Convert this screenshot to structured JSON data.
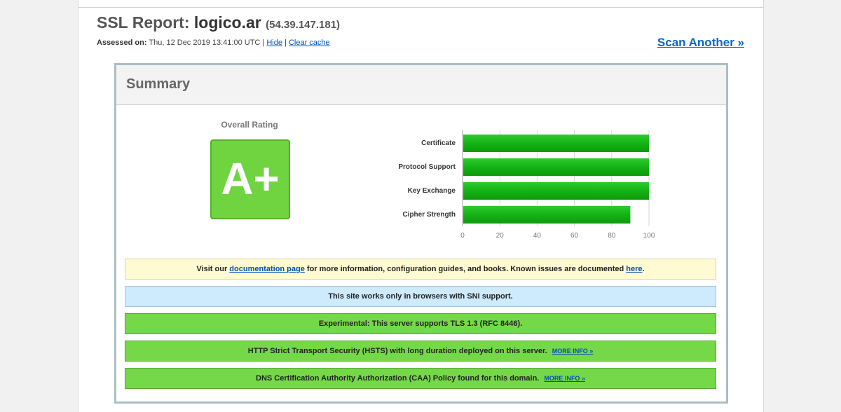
{
  "header": {
    "title_prefix": "SSL Report:",
    "host": "logico.ar",
    "ip": "(54.39.147.181)",
    "assessed_label": "Assessed on:",
    "assessed_value": "Thu, 12 Dec 2019 13:41:00 UTC |",
    "hide_link": "Hide",
    "separator": "|",
    "clear_cache_link": "Clear cache",
    "scan_another": "Scan Another »"
  },
  "summary": {
    "title": "Summary",
    "overall_rating_label": "Overall Rating",
    "grade": "A+",
    "grade_color": "#6fd43f"
  },
  "chart_data": {
    "type": "bar",
    "orientation": "horizontal",
    "categories": [
      "Certificate",
      "Protocol Support",
      "Key Exchange",
      "Cipher Strength"
    ],
    "values": [
      100,
      100,
      100,
      90
    ],
    "xlim": [
      0,
      100
    ],
    "ticks": [
      0,
      20,
      40,
      60,
      80,
      100
    ],
    "grid": true,
    "bar_color": "#17b017"
  },
  "notices": {
    "docs": {
      "before": "Visit our",
      "link": "documentation page",
      "middle": "for more information, configuration guides, and books. Known issues are documented",
      "link2": "here",
      "after": "."
    },
    "sni": {
      "text": "This site works only in browsers with SNI support."
    },
    "tls13": {
      "text": "Experimental: This server supports TLS 1.3 (RFC 8446)."
    },
    "hsts": {
      "text": "HTTP Strict Transport Security (HSTS) with long duration deployed on this server.",
      "more": "MORE INFO »"
    },
    "caa": {
      "text": "DNS Certification Authority Authorization (CAA) Policy found for this domain.",
      "more": "MORE INFO »"
    }
  }
}
